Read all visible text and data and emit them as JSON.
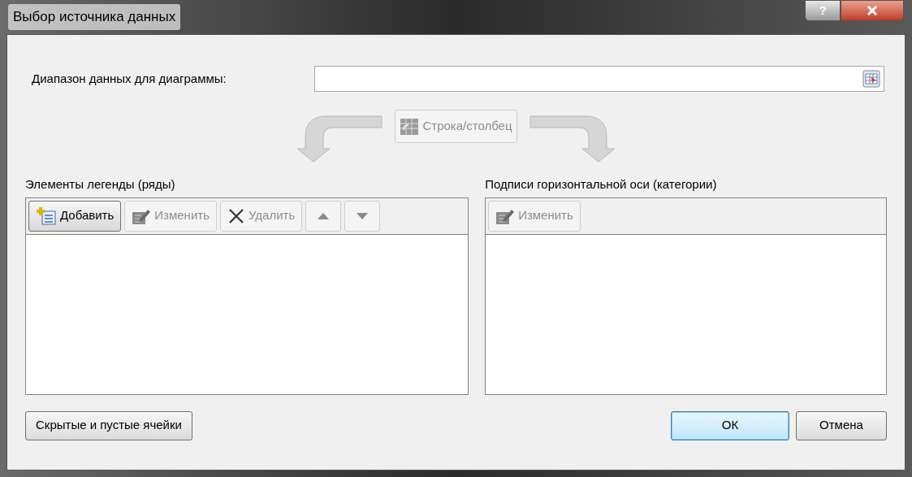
{
  "window": {
    "title": "Выбор источника данных",
    "help_button": "?"
  },
  "range": {
    "label": "Диапазон данных для диаграммы:"
  },
  "switch_button": {
    "label": "Строка/столбец",
    "disabled": true
  },
  "legend": {
    "title": "Элементы легенды (ряды)",
    "buttons": [
      {
        "kind": "add",
        "label": "Добавить",
        "disabled": false,
        "default": true
      },
      {
        "kind": "edit",
        "label": "Изменить",
        "disabled": true,
        "default": false
      },
      {
        "kind": "delete",
        "label": "Удалить",
        "disabled": true,
        "default": false
      },
      {
        "kind": "up",
        "disabled": true,
        "default": false
      },
      {
        "kind": "down",
        "disabled": true,
        "default": false
      }
    ]
  },
  "axis": {
    "title": "Подписи горизонтальной оси (категории)",
    "buttons": [
      {
        "kind": "edit",
        "label": "Изменить",
        "disabled": true,
        "default": false
      }
    ]
  },
  "footer": {
    "hidden_cells_button": "Скрытые и пустые ячейки",
    "ok_button": "ОК",
    "cancel_button": "Отмена"
  }
}
